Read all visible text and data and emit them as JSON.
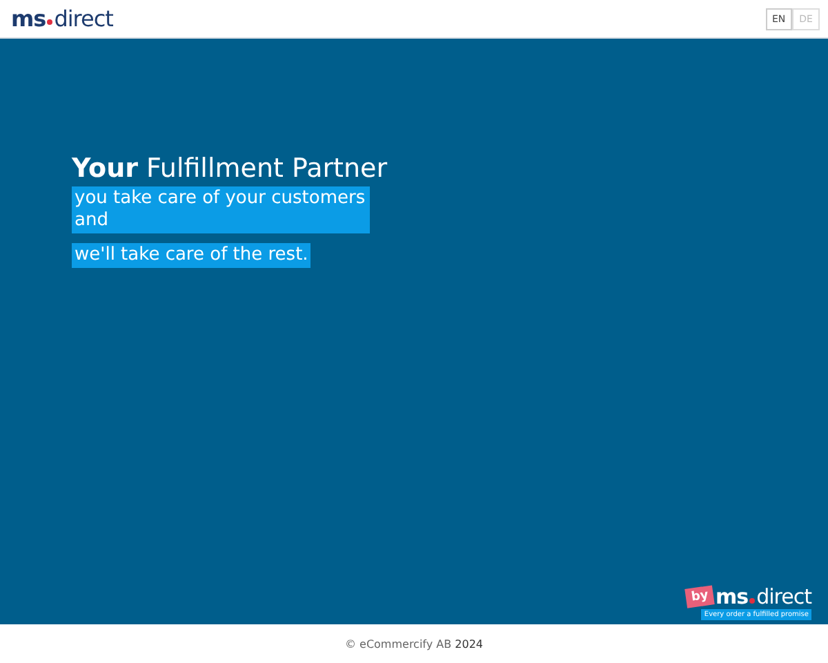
{
  "header": {
    "logo": {
      "part_1": "ms",
      "part_2": "direct"
    },
    "languages": [
      {
        "label": "EN",
        "selected": true
      },
      {
        "label": "DE",
        "selected": false
      }
    ]
  },
  "hero": {
    "title": "**Your** Fulfillment Partner",
    "tagline": [
      "you take care of your customers and",
      "we'll take care of the rest."
    ]
  },
  "badge": {
    "prefix": "by",
    "part_1": "ms",
    "part_2": "direct",
    "slogan": "Every order a fulfilled promise"
  },
  "footer": {
    "copyright": "© eCommercify AB **2024**"
  }
}
